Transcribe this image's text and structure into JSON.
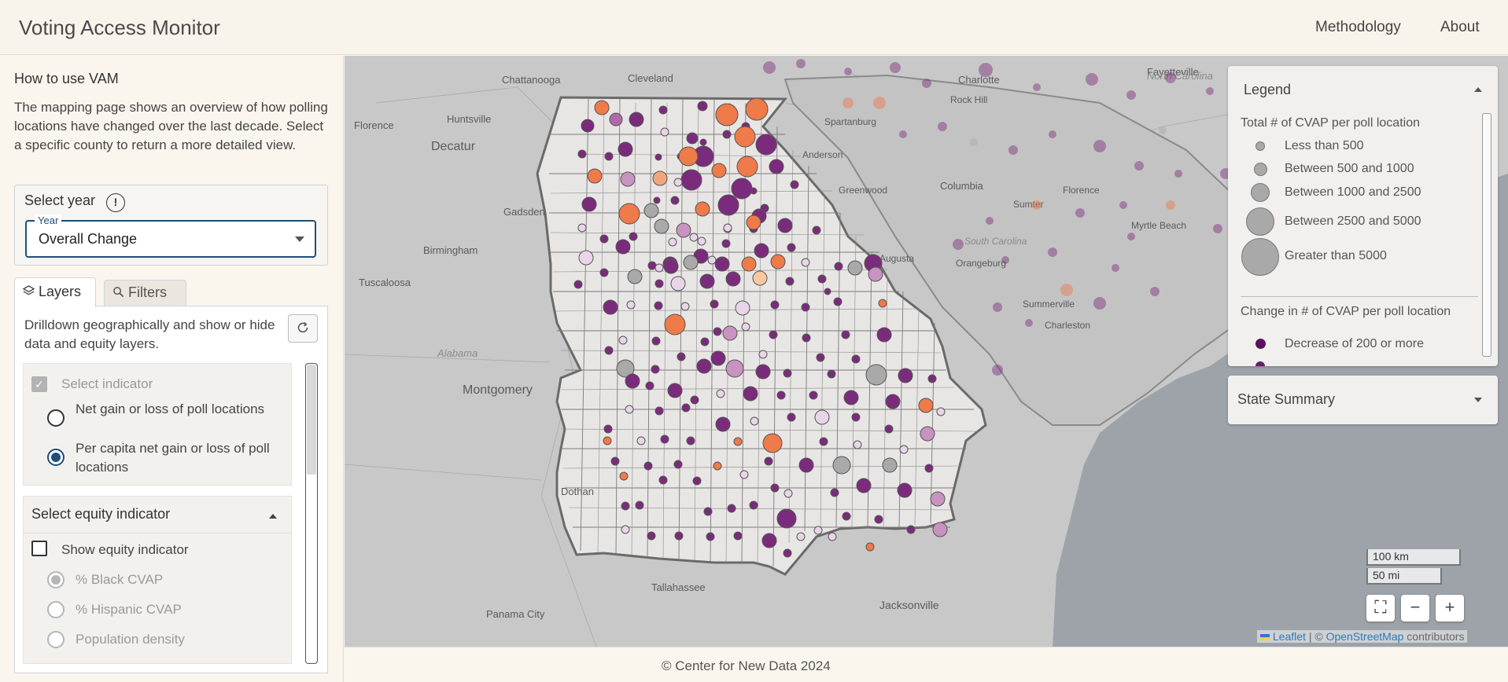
{
  "header": {
    "title": "Voting Access Monitor",
    "nav": [
      "Methodology",
      "About"
    ]
  },
  "sidebar": {
    "howto_title": "How to use VAM",
    "howto_text": "The mapping page shows an overview of how polling locations have changed over the last decade. Select a specific county to return a more detailed view.",
    "year_section_label": "Select year",
    "info_glyph": "!",
    "year_field_label": "Year",
    "year_value": "Overall Change",
    "tabs": {
      "layers": "Layers",
      "filters": "Filters"
    },
    "layers_desc": "Drilldown geographically and show or hide data and equity layers.",
    "indicator": {
      "label": "Select indicator",
      "options": [
        {
          "label": "Net gain or loss of poll locations",
          "selected": false
        },
        {
          "label": "Per capita net gain or loss of poll locations",
          "selected": true
        }
      ]
    },
    "equity": {
      "title": "Select equity indicator",
      "show_label": "Show equity indicator",
      "options": [
        "% Black CVAP",
        "% Hispanic CVAP",
        "Population density"
      ]
    }
  },
  "map": {
    "place_labels": [
      "Chattanooga",
      "Cleveland",
      "Huntsville",
      "Florence",
      "Decatur",
      "Gadsden",
      "Birmingham",
      "Tuscaloosa",
      "Alabama",
      "Montgomery",
      "Dothan",
      "Tallahassee",
      "Panama City",
      "Jacksonville",
      "Charlotte",
      "Fayetteville",
      "North Carolina",
      "Rock Hill",
      "Spartanburg",
      "Anderson",
      "Greenwood",
      "Columbia",
      "Sumter",
      "Florence",
      "Myrtle Beach",
      "Orangeburg",
      "South Carolina",
      "Summerville",
      "Charleston",
      "Augusta"
    ]
  },
  "legend": {
    "title": "Legend",
    "size_title": "Total # of CVAP per poll location",
    "size_items": [
      "Less than 500",
      "Between 500 and 1000",
      "Between 1000 and 2500",
      "Between 2500 and 5000",
      "Greater than 5000"
    ],
    "change_title": "Change in # of CVAP per poll location",
    "change_items": [
      "Decrease of 200 or more"
    ],
    "colors": {
      "decrease": "#6a1a6b",
      "increase": "#ef7a4a",
      "neutral": "#a9a9a9"
    }
  },
  "summary": {
    "title": "State Summary"
  },
  "scale": {
    "km": "100 km",
    "mi": "50 mi"
  },
  "controls": {
    "fullscreen": "⛶",
    "zoom_out": "−",
    "zoom_in": "+"
  },
  "attribution": {
    "leaflet": "Leaflet",
    "sep": "| ©",
    "osm": "OpenStreetMap",
    "suffix": "contributors"
  },
  "footer": {
    "text": "© Center for New Data 2024"
  }
}
